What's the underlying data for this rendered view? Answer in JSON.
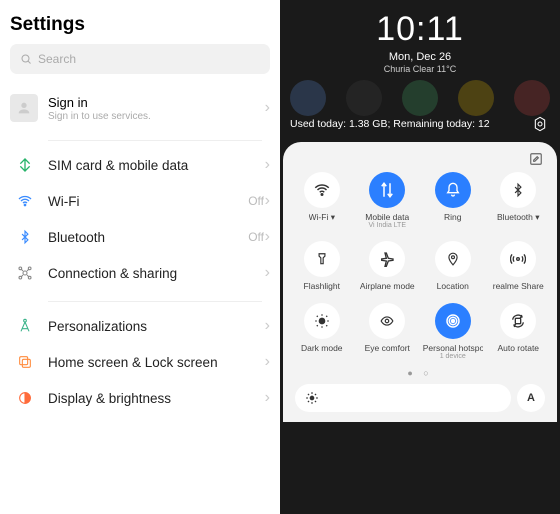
{
  "left": {
    "title": "Settings",
    "search_placeholder": "Search",
    "signin": {
      "title": "Sign in",
      "subtitle": "Sign in to use services."
    },
    "rows": {
      "sim": {
        "label": "SIM card & mobile data"
      },
      "wifi": {
        "label": "Wi-Fi",
        "status": "Off"
      },
      "bt": {
        "label": "Bluetooth",
        "status": "Off"
      },
      "conn": {
        "label": "Connection & sharing"
      },
      "pers": {
        "label": "Personalizations"
      },
      "home": {
        "label": "Home screen & Lock screen"
      },
      "disp": {
        "label": "Display & brightness"
      }
    }
  },
  "right": {
    "clock": "10:11",
    "date": "Mon, Dec 26",
    "weather": "Churia Clear 11°C",
    "data_line": "Used today: 1.38 GB; Remaining today: 12",
    "tiles": {
      "wifi": {
        "label": "Wi-Fi ▾"
      },
      "mobile": {
        "label": "Mobile data",
        "sub": "Vi India LTE"
      },
      "ring": {
        "label": "Ring"
      },
      "bt": {
        "label": "Bluetooth ▾"
      },
      "flash": {
        "label": "Flashlight"
      },
      "airplane": {
        "label": "Airplane mode"
      },
      "location": {
        "label": "Location"
      },
      "rshare": {
        "label": "realme Share"
      },
      "dark": {
        "label": "Dark mode"
      },
      "eye": {
        "label": "Eye comfort"
      },
      "hotspot": {
        "label": "Personal hotspot",
        "sub": "1 device"
      },
      "rotate": {
        "label": "Auto rotate"
      }
    },
    "auto_brightness": "A"
  }
}
